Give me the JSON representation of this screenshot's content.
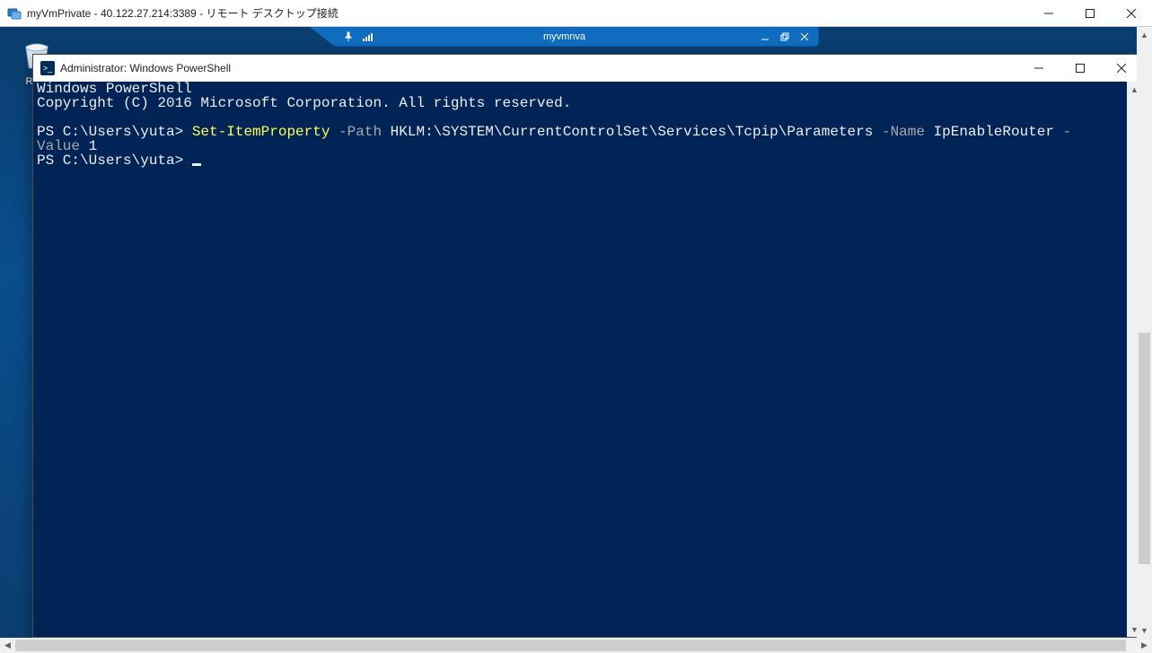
{
  "rdp": {
    "title": "myVmPrivate - 40.122.27.214:3389 - リモート デスクトップ接続",
    "inner_bar_host": "myvmnva"
  },
  "desktop": {
    "recycle_label": "Recy"
  },
  "powershell": {
    "title": "Administrator: Windows PowerShell",
    "banner_line1": "Windows PowerShell",
    "banner_line2": "Copyright (C) 2016 Microsoft Corporation. All rights reserved.",
    "prompt1": "PS C:\\Users\\yuta> ",
    "cmd": "Set-ItemProperty",
    "flag_path": " -Path ",
    "arg_path": "HKLM:\\SYSTEM\\CurrentControlSet\\Services\\Tcpip\\Parameters",
    "flag_name": " -Name ",
    "arg_name": "IpEnableRouter",
    "wrap_tail": " -",
    "line2_flag": "Value ",
    "line2_val": "1",
    "prompt2": "PS C:\\Users\\yuta> "
  }
}
